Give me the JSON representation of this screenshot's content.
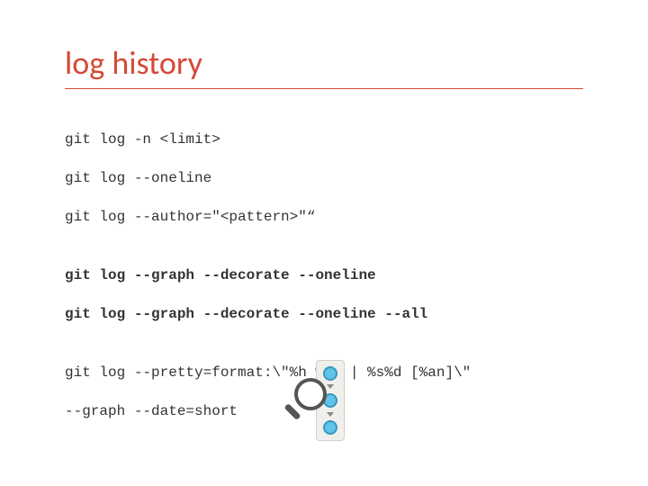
{
  "title": "log history",
  "code": {
    "l1": "git log -n <limit>",
    "l2": "git log --oneline",
    "l3": "git log --author=\"<pattern>\"“",
    "l4": "git log --graph --decorate --oneline",
    "l5": "git log --graph --decorate --oneline --all",
    "l6": "git log --pretty=format:\\\"%h %ad | %s%d [%an]\\\"",
    "l7": "--graph --date=short"
  }
}
